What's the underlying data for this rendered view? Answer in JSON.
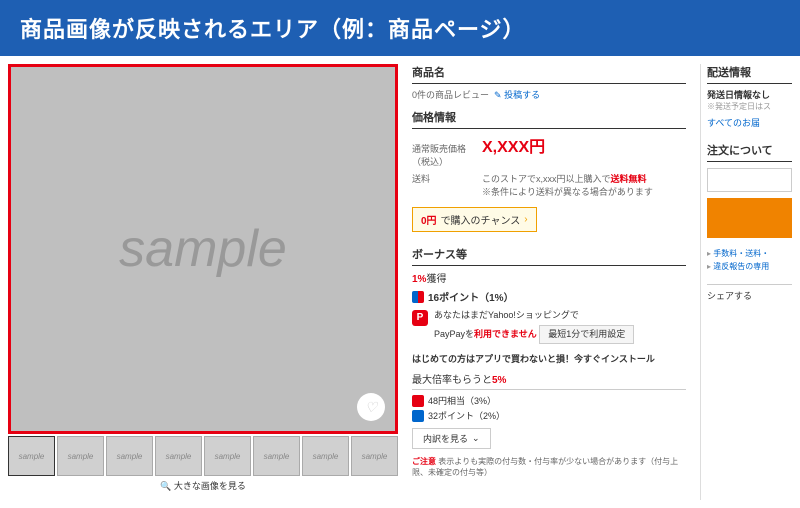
{
  "header": {
    "title": "商品画像が反映されるエリア（例：商品ページ）"
  },
  "image": {
    "watermark": "sample",
    "thumb_label": "sample",
    "view_large": "🔍 大きな画像を見る"
  },
  "product": {
    "name_label": "商品名",
    "review_count": "0件の商品レビュー",
    "review_post": "✎ 投稿する",
    "price_section": "価格情報",
    "price_label": "通常販売価格\n（税込）",
    "price_value": "X,XXX円",
    "ship_label": "送料",
    "ship_text_1": "このストアでx,xxx円以上購入で",
    "ship_free": "送料無料",
    "ship_note": "※条件により送料が異なる場合があります",
    "chance_prefix": "0円",
    "chance_text": "で購入のチャンス",
    "bonus_section": "ボーナス等",
    "bonus_pct": "1%",
    "bonus_pct_suffix": "獲得",
    "points_main": "16ポイント（1%）",
    "paypay_text_1": "あなたはまだYahoo!ショッピングで",
    "paypay_text_2": "PayPayを",
    "paypay_no": "利用できません",
    "setup_btn": "最短1分で利用設定",
    "install_text": "はじめての方はアプリで買わないと損！今すぐインストール",
    "max_rate_prefix": "最大倍率もらうと",
    "max_rate_pct": "5%",
    "rate_item_1": "48円相当（3%）",
    "rate_item_2": "32ポイント（2%）",
    "detail_btn": "内訳を見る",
    "caution_label": "ご注意",
    "caution_text": "表示よりも実際の付与数・付与率が少ない場合があります（付与上限、未確定の付与等）"
  },
  "delivery": {
    "section": "配送情報",
    "sub": "発送日情報なし",
    "note": "※発送予定日はス",
    "link": "すべてのお届"
  },
  "order": {
    "section": "注文について",
    "links": [
      "手数料・送料・",
      "違反報告の専用"
    ],
    "share": "シェアする"
  }
}
